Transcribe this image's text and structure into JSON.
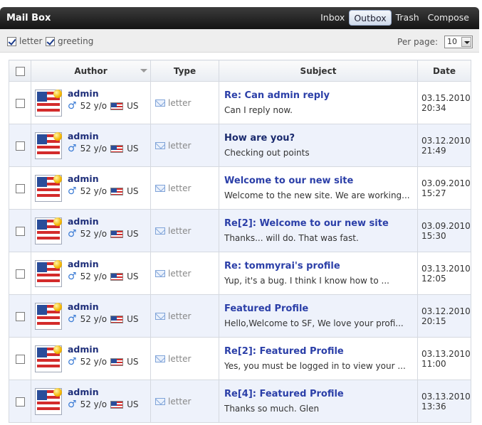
{
  "header": {
    "title": "Mail Box",
    "tabs": [
      {
        "label": "Inbox",
        "active": false
      },
      {
        "label": "Outbox",
        "active": true
      },
      {
        "label": "Trash",
        "active": false
      },
      {
        "label": "Compose",
        "active": false
      }
    ]
  },
  "filters": {
    "letter_label": "letter",
    "greeting_label": "greeting",
    "per_page_label": "Per page:",
    "per_page_value": "10"
  },
  "columns": {
    "author": "Author",
    "type": "Type",
    "subject": "Subject",
    "date": "Date"
  },
  "rows": [
    {
      "author": "admin",
      "age": "52 y/o",
      "country": "US",
      "type": "letter",
      "subject": "Re: Can admin reply",
      "snippet": "Can I reply now.",
      "date": "03.15.2010",
      "time": "20:34"
    },
    {
      "author": "admin",
      "age": "52 y/o",
      "country": "US",
      "type": "letter",
      "subject": "How are you?",
      "snippet": "Checking out points",
      "date": "03.12.2010",
      "time": "21:49"
    },
    {
      "author": "admin",
      "age": "52 y/o",
      "country": "US",
      "type": "letter",
      "subject": "Welcome to our new site",
      "snippet": "Welcome to the new site.  We are working...",
      "date": "03.09.2010",
      "time": "15:27"
    },
    {
      "author": "admin",
      "age": "52 y/o",
      "country": "US",
      "type": "letter",
      "subject": "Re[2]: Welcome to our new site",
      "snippet": "Thanks... will do.  That was fast.",
      "date": "03.09.2010",
      "time": "15:30"
    },
    {
      "author": "admin",
      "age": "52 y/o",
      "country": "US",
      "type": "letter",
      "subject": "Re: tommyrai's profile",
      "snippet": "Yup, it's a bug.  I think I know how to ...",
      "date": "03.13.2010",
      "time": "12:05"
    },
    {
      "author": "admin",
      "age": "52 y/o",
      "country": "US",
      "type": "letter",
      "subject": "Featured Profile",
      "snippet": "Hello,Welcome to SF,  We love your profi...",
      "date": "03.12.2010",
      "time": "20:15"
    },
    {
      "author": "admin",
      "age": "52 y/o",
      "country": "US",
      "type": "letter",
      "subject": "Re[2]: Featured Profile",
      "snippet": "Yes, you must be logged in to view your ...",
      "date": "03.13.2010",
      "time": "11:00"
    },
    {
      "author": "admin",
      "age": "52 y/o",
      "country": "US",
      "type": "letter",
      "subject": "Re[4]: Featured Profile",
      "snippet": "Thanks so much. Glen",
      "date": "03.13.2010",
      "time": "13:36"
    }
  ]
}
